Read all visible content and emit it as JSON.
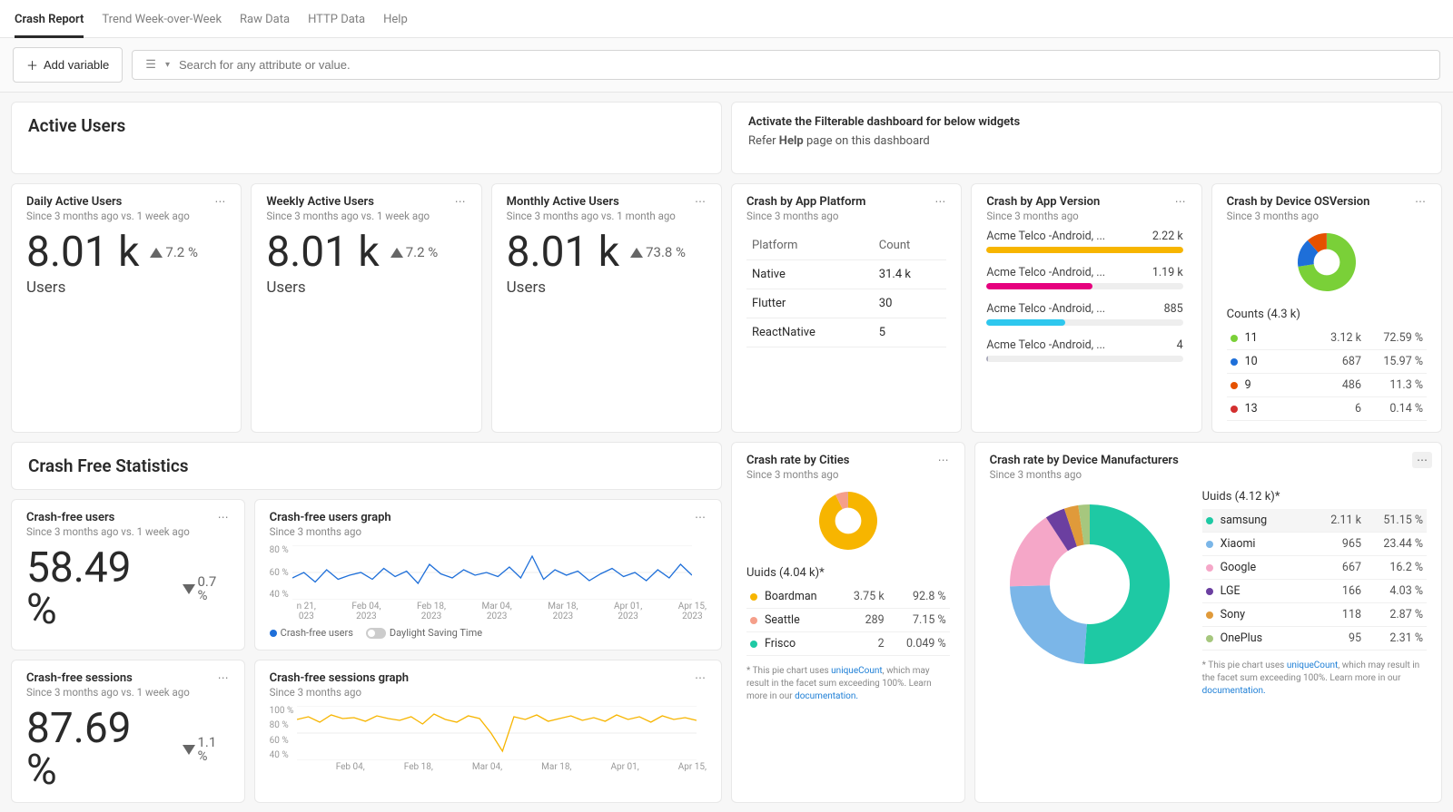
{
  "tabs": [
    "Crash Report",
    "Trend Week-over-Week",
    "Raw Data",
    "HTTP Data",
    "Help"
  ],
  "active_tab": 0,
  "toolbar": {
    "add_variable": "Add variable",
    "search_placeholder": "Search for any attribute or value."
  },
  "left_header": {
    "title": "Active Users"
  },
  "right_header": {
    "title": "Activate the Filterable dashboard for below widgets",
    "note_pre": "Refer ",
    "note_bold": "Help",
    "note_post": " page on this dashboard"
  },
  "au_cards": [
    {
      "title": "Daily Active Users",
      "sub": "Since 3 months ago vs. 1 week ago",
      "value": "8.01 k",
      "change": "7.2 %",
      "dir": "up",
      "unit": "Users"
    },
    {
      "title": "Weekly Active Users",
      "sub": "Since 3 months ago vs. 1 week ago",
      "value": "8.01 k",
      "change": "7.2 %",
      "dir": "up",
      "unit": "Users"
    },
    {
      "title": "Monthly Active Users",
      "sub": "Since 3 months ago vs. 1 month ago",
      "value": "8.01 k",
      "change": "73.8 %",
      "dir": "up",
      "unit": "Users"
    }
  ],
  "crash_platform": {
    "title": "Crash by App Platform",
    "sub": "Since 3 months ago",
    "headers": [
      "Platform",
      "Count"
    ],
    "rows": [
      [
        "Native",
        "31.4 k"
      ],
      [
        "Flutter",
        "30"
      ],
      [
        "ReactNative",
        "5"
      ]
    ]
  },
  "crash_version": {
    "title": "Crash by App Version",
    "sub": "Since 3 months ago",
    "rows": [
      {
        "label": "Acme Telco -Android, ...",
        "value": "2.22 k",
        "pct": 100,
        "color": "#f7b500"
      },
      {
        "label": "Acme Telco -Android, ...",
        "value": "1.19 k",
        "pct": 54,
        "color": "#e6007e"
      },
      {
        "label": "Acme Telco -Android, ...",
        "value": "885",
        "pct": 40,
        "color": "#2ec7ee"
      },
      {
        "label": "Acme Telco -Android, ...",
        "value": "4",
        "pct": 1,
        "color": "#aab"
      }
    ]
  },
  "crash_os": {
    "title": "Crash by Device OSVersion",
    "sub": "Since 3 months ago",
    "legend_title": "Counts (4.3 k)",
    "rows": [
      {
        "label": "11",
        "v1": "3.12 k",
        "v2": "72.59 %",
        "color": "#7AD038"
      },
      {
        "label": "10",
        "v1": "687",
        "v2": "15.97 %",
        "color": "#1e6fd9"
      },
      {
        "label": "9",
        "v1": "486",
        "v2": "11.3 %",
        "color": "#e55100"
      },
      {
        "label": "13",
        "v1": "6",
        "v2": "0.14 %",
        "color": "#d32f2f"
      }
    ]
  },
  "cfstats_header": {
    "title": "Crash Free Statistics"
  },
  "cfusers": {
    "title": "Crash-free users",
    "sub": "Since 3 months ago vs. 1 week ago",
    "value": "58.49 %",
    "change": "0.7 %",
    "dir": "down"
  },
  "cfusers_graph": {
    "title": "Crash-free users graph",
    "sub": "Since 3 months ago",
    "legend_items": [
      "Crash-free users",
      "Daylight Saving Time"
    ],
    "legend_color": "#1e6fd9",
    "y_ticks": [
      "80 %",
      "60 %",
      "40 %"
    ],
    "x_ticks": [
      "n 21,\n023",
      "Feb 04,\n2023",
      "Feb 18,\n2023",
      "Mar 04,\n2023",
      "Mar 18,\n2023",
      "Apr 01,\n2023",
      "Apr 15,\n2023"
    ]
  },
  "cfsessions": {
    "title": "Crash-free sessions",
    "sub": "Since 3 months ago vs. 1 week ago",
    "value": "87.69 %",
    "change": "1.1 %",
    "dir": "down"
  },
  "cfsessions_graph": {
    "title": "Crash-free sessions graph",
    "sub": "Since 3 months ago",
    "y_ticks": [
      "100 %",
      "80 %",
      "60 %",
      "40 %"
    ],
    "x_ticks": [
      "",
      "Feb 04,",
      "Feb 18,",
      "Mar 04,",
      "Mar 18,",
      "Apr 01,",
      "Apr 15,"
    ]
  },
  "crash_cities": {
    "title": "Crash rate by Cities",
    "sub": "Since 3 months ago",
    "legend_title": "Uuids (4.04 k)*",
    "rows": [
      {
        "label": "Boardman",
        "v1": "3.75 k",
        "v2": "92.8 %",
        "color": "#f7b500"
      },
      {
        "label": "Seattle",
        "v1": "289",
        "v2": "7.15 %",
        "color": "#f59f8a"
      },
      {
        "label": "Frisco",
        "v1": "2",
        "v2": "0.049 %",
        "color": "#1ec9a4"
      }
    ],
    "note": {
      "pre": "* This pie chart uses ",
      "link": "uniqueCount",
      "mid": ", which may result in the facet sum exceeding 100%. Learn more in our ",
      "doc": "documentation."
    }
  },
  "crash_mfg": {
    "title": "Crash rate by Device Manufacturers",
    "sub": "Since 3 months ago",
    "legend_title": "Uuids (4.12 k)*",
    "rows": [
      {
        "label": "samsung",
        "v1": "2.11 k",
        "v2": "51.15 %",
        "color": "#1ec9a4"
      },
      {
        "label": "Xiaomi",
        "v1": "965",
        "v2": "23.44 %",
        "color": "#7bb6e8"
      },
      {
        "label": "Google",
        "v1": "667",
        "v2": "16.2 %",
        "color": "#f5a7c8"
      },
      {
        "label": "LGE",
        "v1": "166",
        "v2": "4.03 %",
        "color": "#6b3fa0"
      },
      {
        "label": "Sony",
        "v1": "118",
        "v2": "2.87 %",
        "color": "#e09a3a"
      },
      {
        "label": "OnePlus",
        "v1": "95",
        "v2": "2.31 %",
        "color": "#a6c77e"
      }
    ],
    "note": {
      "pre": "* This pie chart uses ",
      "link": "uniqueCount",
      "mid": ", which may result in the facet sum exceeding 100%. Learn more in our ",
      "doc": "documentation."
    }
  },
  "chart_data": [
    {
      "id": "crash_os_donut",
      "type": "pie",
      "series": [
        {
          "name": "11",
          "value": 72.59,
          "color": "#7AD038"
        },
        {
          "name": "10",
          "value": 15.97,
          "color": "#1e6fd9"
        },
        {
          "name": "9",
          "value": 11.3,
          "color": "#e55100"
        },
        {
          "name": "13",
          "value": 0.14,
          "color": "#d32f2f"
        }
      ]
    },
    {
      "id": "crash_cities_donut",
      "type": "pie",
      "series": [
        {
          "name": "Boardman",
          "value": 92.8,
          "color": "#f7b500"
        },
        {
          "name": "Seattle",
          "value": 7.15,
          "color": "#f59f8a"
        },
        {
          "name": "Frisco",
          "value": 0.049,
          "color": "#1ec9a4"
        }
      ]
    },
    {
      "id": "crash_mfg_donut",
      "type": "pie",
      "series": [
        {
          "name": "samsung",
          "value": 51.15,
          "color": "#1ec9a4"
        },
        {
          "name": "Xiaomi",
          "value": 23.44,
          "color": "#7bb6e8"
        },
        {
          "name": "Google",
          "value": 16.2,
          "color": "#f5a7c8"
        },
        {
          "name": "LGE",
          "value": 4.03,
          "color": "#6b3fa0"
        },
        {
          "name": "Sony",
          "value": 2.87,
          "color": "#e09a3a"
        },
        {
          "name": "OnePlus",
          "value": 2.31,
          "color": "#a6c77e"
        }
      ]
    },
    {
      "id": "cfusers_line",
      "type": "line",
      "ylim": [
        40,
        80
      ],
      "y": [
        56,
        60,
        53,
        62,
        55,
        58,
        60,
        55,
        63,
        57,
        61,
        52,
        66,
        59,
        56,
        62,
        58,
        60,
        57,
        64,
        56,
        72,
        55,
        62,
        58,
        61,
        54,
        59,
        63,
        57,
        60,
        54,
        62,
        56,
        66,
        58
      ],
      "color": "#1e6fd9"
    },
    {
      "id": "cfsessions_line",
      "type": "line",
      "ylim": [
        40,
        100
      ],
      "y": [
        85,
        88,
        82,
        90,
        86,
        87,
        83,
        89,
        86,
        84,
        88,
        80,
        91,
        85,
        82,
        89,
        86,
        70,
        50,
        88,
        85,
        90,
        83,
        86,
        89,
        84,
        87,
        83,
        90,
        85,
        88,
        82,
        89,
        85,
        87,
        84
      ],
      "color": "#f7b500"
    }
  ]
}
